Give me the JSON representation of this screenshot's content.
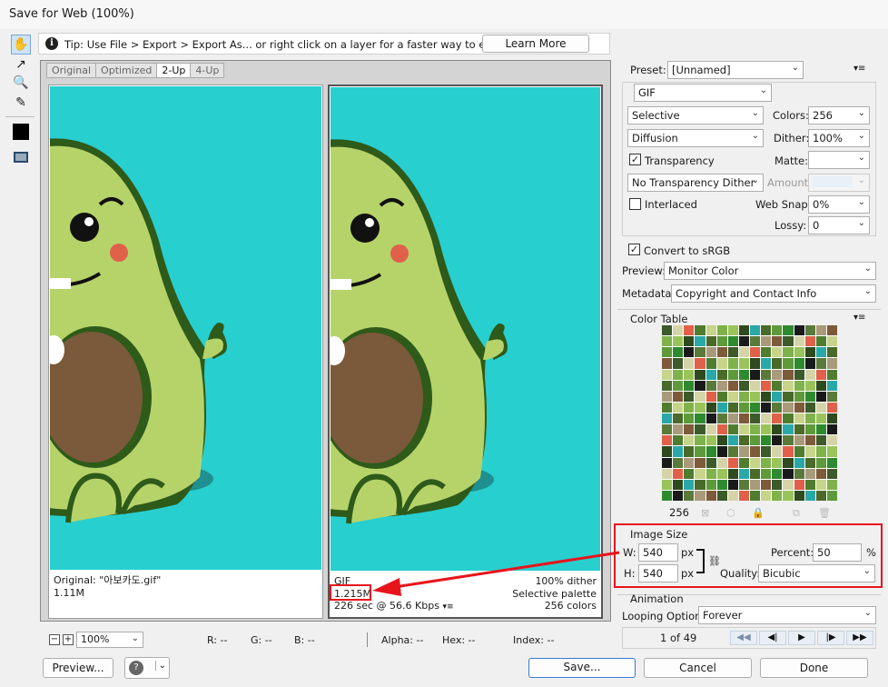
{
  "window": {
    "title": "Save for Web (100%)"
  },
  "tip": {
    "text": "Tip: Use File > Export > Export As...  or right click on a layer for a faster way to export assets",
    "learn_more": "Learn More"
  },
  "tabs": [
    "Original",
    "Optimized",
    "2-Up",
    "4-Up"
  ],
  "panes": {
    "original": {
      "line1": "Original: \"아보카도.gif\"",
      "line2": "1.11M"
    },
    "optimized": {
      "format": "GIF",
      "size": "1.215M",
      "time": "226 sec @ 56.6 Kbps",
      "dither": "100% dither",
      "palette": "Selective palette",
      "colors": "256 colors"
    }
  },
  "status": {
    "zoom": "100%",
    "r": "R: --",
    "g": "G: --",
    "b": "B: --",
    "alpha": "Alpha: --",
    "hex": "Hex: --",
    "index": "Index: --"
  },
  "settings": {
    "preset_label": "Preset:",
    "preset_value": "[Unnamed]",
    "format": "GIF",
    "reduction": "Selective",
    "colors_label": "Colors:",
    "colors_value": "256",
    "dither_algo": "Diffusion",
    "dither_label": "Dither:",
    "dither_value": "100%",
    "transparency": "Transparency",
    "matte_label": "Matte:",
    "trans_dither": "No Transparency Dither",
    "amount_label": "Amount:",
    "interlaced": "Interlaced",
    "websnap_label": "Web Snap:",
    "websnap_value": "0%",
    "lossy_label": "Lossy:",
    "lossy_value": "0",
    "srgb": "Convert to sRGB",
    "preview_label": "Preview:",
    "preview_value": "Monitor Color",
    "metadata_label": "Metadata:",
    "metadata_value": "Copyright and Contact Info"
  },
  "color_table": {
    "title": "Color Table",
    "count": "256",
    "swatches": [
      "#3c5a2a",
      "#2e4a1e",
      "#a89a7a",
      "#7fb24a",
      "#1a1a1a",
      "#4f7d2f",
      "#5e9a3a",
      "#d4d4a8",
      "#2aa8a8",
      "#7d5a3a",
      "#9ac45a",
      "#5a7a3a",
      "#c8d48a",
      "#2e8a2e",
      "#e0604a",
      "#4a6a2a"
    ],
    "icons": [
      "web-shift-icon",
      "cube-icon",
      "lock-icon",
      "new-color-icon",
      "trash-icon"
    ]
  },
  "image_size": {
    "title": "Image Size",
    "w_label": "W:",
    "w_value": "540",
    "h_label": "H:",
    "h_value": "540",
    "unit": "px",
    "percent_label": "Percent:",
    "percent_value": "50",
    "percent_unit": "%",
    "quality_label": "Quality:",
    "quality_value": "Bicubic"
  },
  "animation": {
    "title": "Animation",
    "looping_label": "Looping Options:",
    "looping_value": "Forever",
    "frame": "1 of 49"
  },
  "footer": {
    "preview": "Preview...",
    "save": "Save...",
    "cancel": "Cancel",
    "done": "Done"
  },
  "colors": {
    "accent": "#3a7bd5",
    "highlight": "#e8141b",
    "canvas": "#28cfcf"
  }
}
